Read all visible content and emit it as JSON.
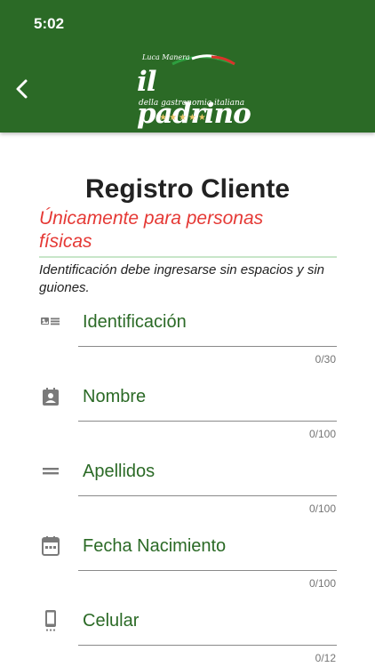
{
  "status_bar": {
    "time": "5:02"
  },
  "header": {
    "logo": {
      "top_text": "Luca Manera",
      "brand": "il padrino",
      "tagline": "della gastronomia italiana",
      "stars": "★★★★★"
    },
    "colors": {
      "appbar": "#2b6a26",
      "stars": "#e8c66a"
    }
  },
  "form": {
    "title": "Registro Cliente",
    "subtitle": "Únicamente para personas físicas",
    "hint": "Identificación debe ingresarse sin espacios y sin guiones.",
    "fields": [
      {
        "label": "Identificación",
        "counter": "0/30",
        "icon": "id-card-icon"
      },
      {
        "label": "Nombre",
        "counter": "0/100",
        "icon": "contact-badge-icon"
      },
      {
        "label": "Apellidos",
        "counter": "0/100",
        "icon": "equals-icon"
      },
      {
        "label": "Fecha Nacimiento",
        "counter": "0/100",
        "icon": "calendar-icon"
      },
      {
        "label": "Celular",
        "counter": "0/12",
        "icon": "phone-icon"
      }
    ]
  },
  "colors": {
    "label_green": "#2b6a26",
    "subtitle_red": "#e53935"
  }
}
